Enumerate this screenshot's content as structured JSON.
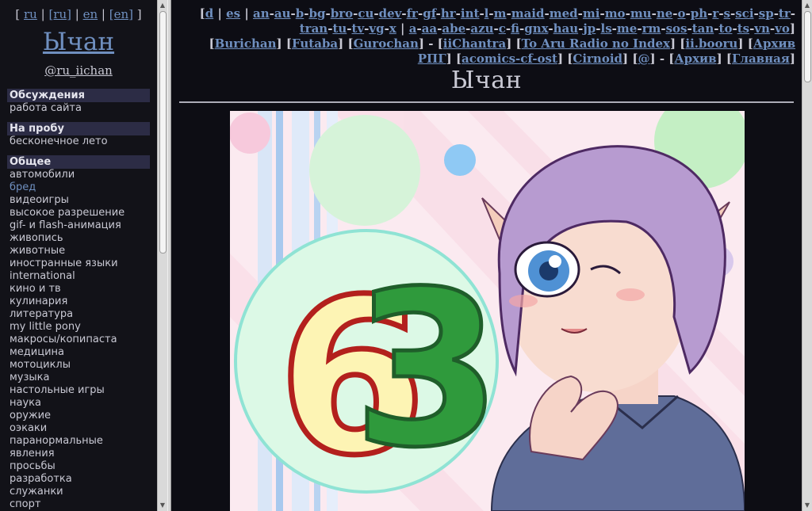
{
  "sidebar": {
    "lang_links": [
      {
        "label": "ru"
      },
      {
        "label": "[ru]"
      },
      {
        "label": "en"
      },
      {
        "label": "[en]"
      }
    ],
    "site_title": "Ычан",
    "site_handle": "@ru_iichan",
    "sections": [
      {
        "title": "Обсуждения",
        "items": [
          "работа сайта"
        ]
      },
      {
        "title": "На пробу",
        "items": [
          "бесконечное лето"
        ]
      },
      {
        "title": "Общее",
        "items": [
          "автомобили",
          "бред",
          "видеоигры",
          "высокое разрешение",
          "gif- и flash-анимация",
          "живопись",
          "животные",
          "иностранные языки",
          "international",
          "кино и тв",
          "кулинария",
          "литература",
          "my little pony",
          "макросы/копипаста",
          "медицина",
          "мотоциклы",
          "музыка",
          "настольные игры",
          "наука",
          "оружие",
          "оэкаки",
          "паранормальные",
          "явления",
          "просьбы",
          "разработка",
          "служанки",
          "спорт"
        ]
      }
    ],
    "active_item": "бред"
  },
  "main": {
    "board_groups": [
      {
        "links": [
          "d",
          "es"
        ]
      },
      {
        "links": [
          "an",
          "au",
          "b",
          "bg",
          "bro",
          "cu",
          "dev",
          "fr",
          "gf",
          "hr",
          "int",
          "l",
          "m",
          "maid",
          "med",
          "mi",
          "mo",
          "mu",
          "ne",
          "o",
          "ph",
          "r",
          "s",
          "sci",
          "sp",
          "tr",
          "tran",
          "tu",
          "tv",
          "vg",
          "x"
        ]
      },
      {
        "links": [
          "a",
          "aa",
          "abe",
          "azu",
          "c",
          "fi",
          "gnx",
          "hau",
          "jp",
          "ls",
          "me",
          "rm",
          "sos",
          "tan",
          "to",
          "ts",
          "vn",
          "vo"
        ]
      }
    ],
    "external_links": [
      "Burichan",
      "Futaba",
      "Gurochan",
      "iiChantra",
      "To Aru Radio no Index",
      "ii.booru",
      "Архив РПГ",
      "acomics-cf-ost",
      "Cirnoid",
      "@",
      "Архив",
      "Главная"
    ],
    "board_title": "Ычан",
    "banner": {
      "number_left": "6",
      "number_right": "3"
    }
  },
  "colors": {
    "background": "#0d0d14",
    "link": "#6f8fbf",
    "text": "#c9c9d4",
    "section_head_bg": "#2c2c45",
    "number_six_fill": "#fdf4b4",
    "number_six_outline": "#b3201d",
    "number_three_fill": "#2f9a3c",
    "hair": "#b79bd0",
    "eye": "#4f91d4"
  }
}
